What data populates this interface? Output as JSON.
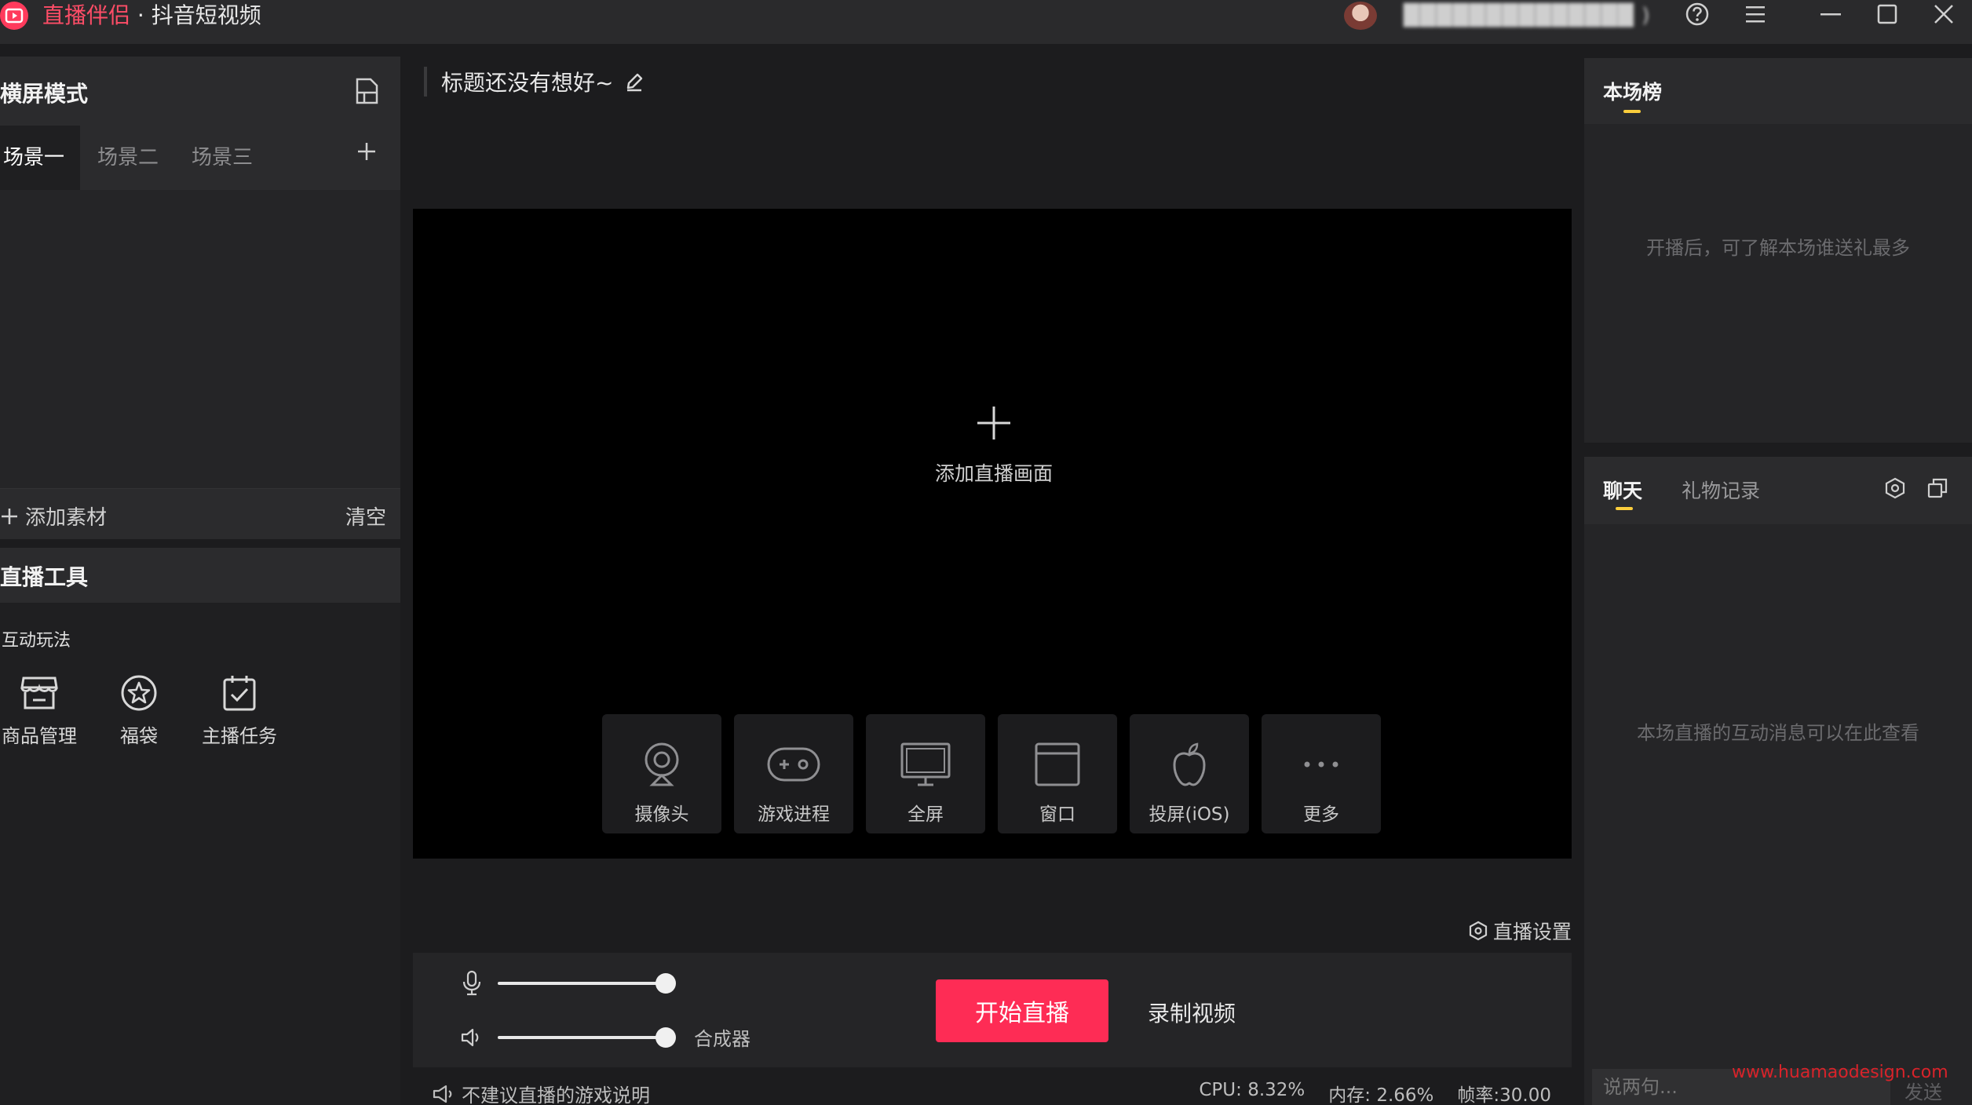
{
  "titlebar": {
    "brand": "直播伴侣",
    "separator": "·",
    "platform": "抖音短视频",
    "user_name": "██████████████ )",
    "icons": [
      "help-icon",
      "menu-icon",
      "minimize-icon",
      "maximize-icon",
      "close-icon"
    ]
  },
  "left": {
    "mode_title": "横屏模式",
    "scenes": [
      "场景一",
      "场景二",
      "场景三"
    ],
    "active_scene": "场景一",
    "add_material": "添加素材",
    "clear": "清空"
  },
  "tools": {
    "title": "直播工具",
    "section": "互动玩法",
    "items": [
      {
        "label": "商品管理",
        "icon": "shop-icon"
      },
      {
        "label": "福袋",
        "icon": "star-badge-icon"
      },
      {
        "label": "主播任务",
        "icon": "task-check-icon"
      }
    ]
  },
  "center": {
    "stream_title": "标题还没有想好~",
    "add_scene": "添加直播画面",
    "sources": [
      {
        "label": "摄像头",
        "icon": "camera-icon"
      },
      {
        "label": "游戏进程",
        "icon": "gamepad-icon"
      },
      {
        "label": "全屏",
        "icon": "monitor-icon"
      },
      {
        "label": "窗口",
        "icon": "window-icon"
      },
      {
        "label": "投屏(iOS)",
        "icon": "apple-icon"
      },
      {
        "label": "更多",
        "icon": "more-icon"
      }
    ],
    "live_settings": "直播设置",
    "mixer_label": "合成器",
    "start_live": "开始直播",
    "record_video": "录制视频",
    "mic_volume": 1.0,
    "speaker_volume": 1.0
  },
  "status": {
    "warning": "不建议直播的游戏说明",
    "cpu": "CPU: 8.32%",
    "memory": "内存: 2.66%",
    "fps": "帧率:30.00"
  },
  "right": {
    "rank_title": "本场榜",
    "rank_hint": "开播后，可了解本场谁送礼最多",
    "chat_tabs": [
      "聊天",
      "礼物记录"
    ],
    "chat_hint": "本场直播的互动消息可以在此查看",
    "chat_placeholder": "说两句...",
    "send": "发送"
  },
  "watermark": "www.huamaodesign.com",
  "colors": {
    "accent": "#fe2c55",
    "tab_indicator": "#facd3c",
    "background": "#1c1c1e",
    "panel": "#252527"
  }
}
